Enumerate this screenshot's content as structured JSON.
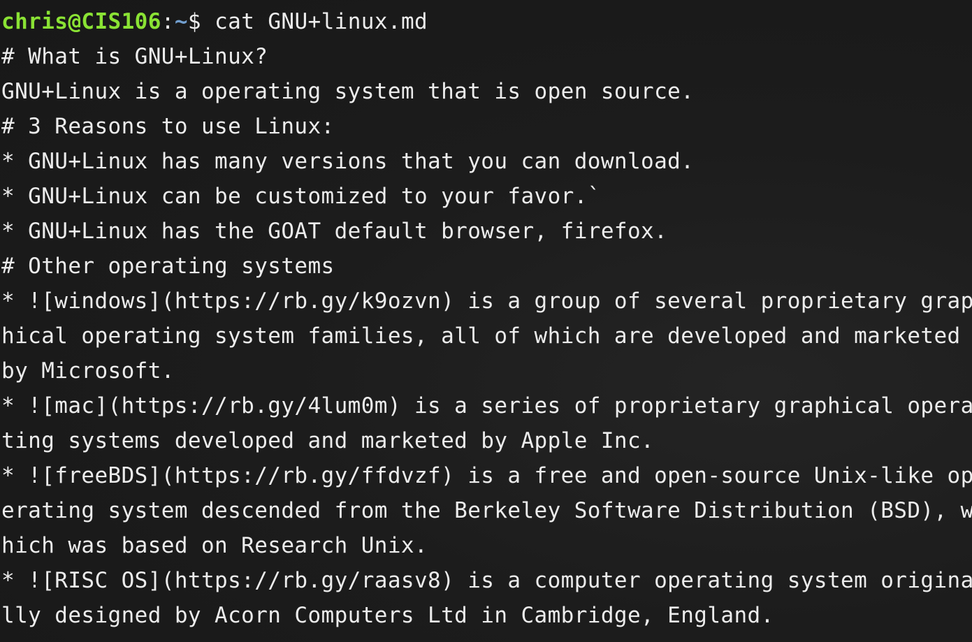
{
  "prompt": {
    "user_host": "chris@CIS106",
    "separator": ":",
    "path": "~",
    "symbol": "$ ",
    "command": "cat GNU+linux.md"
  },
  "output_lines": [
    "# What is GNU+Linux?",
    "GNU+Linux is a operating system that is open source.",
    "# 3 Reasons to use Linux:",
    "* GNU+Linux has many versions that you can download.",
    "* GNU+Linux can be customized to your favor.`",
    "* GNU+Linux has the GOAT default browser, firefox.",
    "# Other operating systems",
    "* ![windows](https://rb.gy/k9ozvn) is a group of several proprietary grap",
    "hical operating system families, all of which are developed and marketed",
    "by Microsoft.",
    "* ![mac](https://rb.gy/4lum0m) is a series of proprietary graphical opera",
    "ting systems developed and marketed by Apple Inc.",
    "* ![freeBDS](https://rb.gy/ffdvzf) is a free and open-source Unix-like op",
    "erating system descended from the Berkeley Software Distribution (BSD), w",
    "hich was based on Research Unix.",
    "* ![RISC OS](https://rb.gy/raasv8) is a computer operating system origina",
    "lly designed by Acorn Computers Ltd in Cambridge, England."
  ],
  "colors": {
    "background": "#1c1c1c",
    "foreground": "#ececec",
    "prompt_user": "#8ae234",
    "prompt_path": "#729fcf"
  }
}
